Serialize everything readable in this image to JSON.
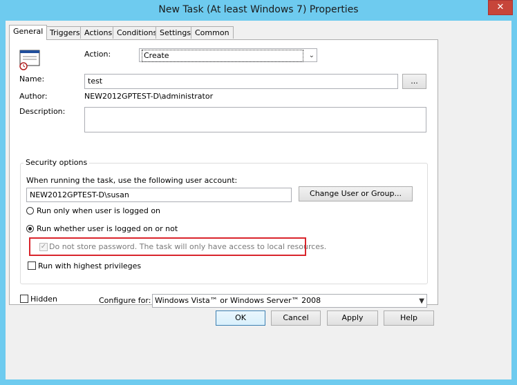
{
  "window": {
    "title": "New Task (At least Windows 7) Properties",
    "close_glyph": "✕"
  },
  "tabs": [
    "General",
    "Triggers",
    "Actions",
    "Conditions",
    "Settings",
    "Common"
  ],
  "general": {
    "action_label": "Action:",
    "action_value": "Create",
    "name_label": "Name:",
    "name_value": "test",
    "browse_label": "...",
    "author_label": "Author:",
    "author_value": "NEW2012GPTEST-D\\administrator",
    "description_label": "Description:",
    "description_value": "",
    "security": {
      "title": "Security options",
      "account_prompt": "When running the task, use the following user account:",
      "account_value": "NEW2012GPTEST-D\\susan",
      "change_button": "Change User or Group...",
      "radio_logged_on": "Run only when user is logged on",
      "radio_whether": "Run whether user is logged on or not",
      "selected_radio": "whether",
      "no_store_password": "Do not store password. The task will only have access to local resources.",
      "no_store_password_checked": true,
      "no_store_password_enabled": false,
      "highest_privileges": "Run with highest privileges",
      "highest_privileges_checked": false
    },
    "hidden_label": "Hidden",
    "hidden_checked": false,
    "configure_label": "Configure for:",
    "configure_value": "Windows Vista™ or Windows Server™ 2008"
  },
  "buttons": {
    "ok": "OK",
    "cancel": "Cancel",
    "apply": "Apply",
    "help": "Help"
  },
  "icons": {
    "task_icon": "scheduled-task-icon",
    "dropdown": "chevron-down-icon"
  },
  "colors": {
    "title_bar": "#6ecbef",
    "highlight_border": "#d9242b",
    "close_button": "#c7453a"
  }
}
